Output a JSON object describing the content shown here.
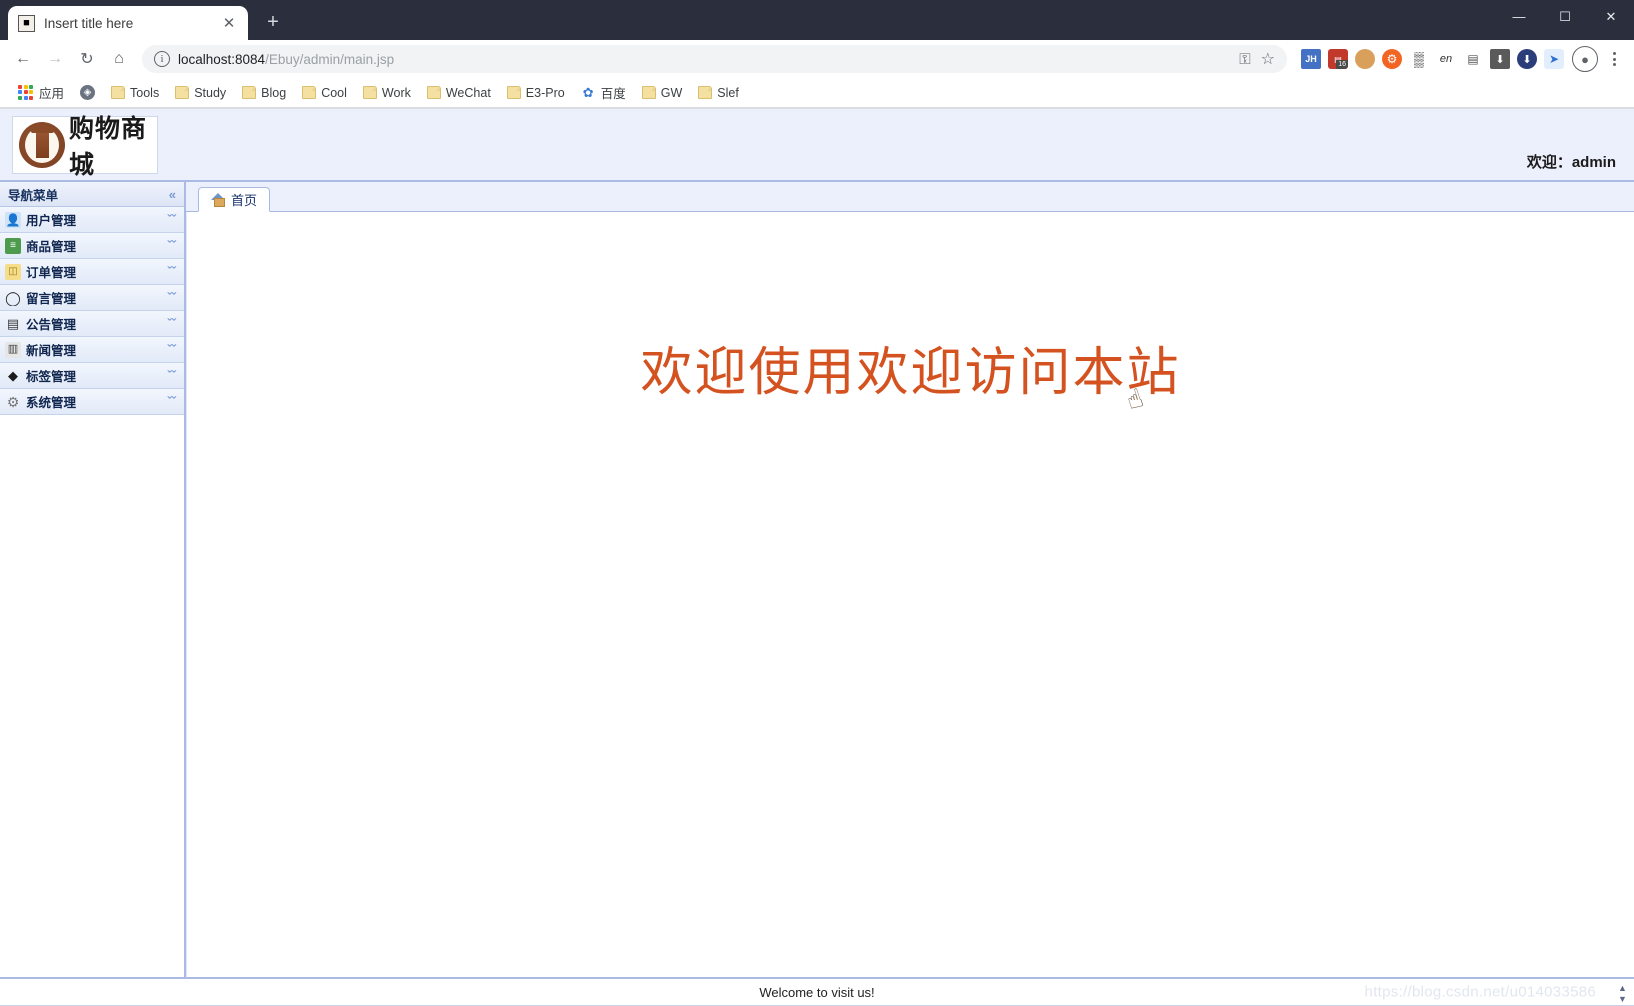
{
  "browser": {
    "tab": {
      "title": "Insert title here",
      "favicon": "jsp-favicon",
      "close_label": "✕"
    },
    "new_tab_label": "+",
    "window_controls": {
      "minimize": "—",
      "maximize": "☐",
      "close": "✕"
    },
    "nav": {
      "back": "←",
      "forward": "→",
      "reload": "↻",
      "home": "⌂"
    },
    "omnibox": {
      "host": "localhost:8084",
      "path": "/Ebuy/admin/main.jsp",
      "info_icon": "i",
      "key_icon": "⚿",
      "star_icon": "☆"
    },
    "extensions": [
      {
        "name": "jh-extension-icon",
        "label": "JH"
      },
      {
        "name": "calendar-extension-icon",
        "label": "▤",
        "badge": "16"
      },
      {
        "name": "monkey-extension-icon",
        "label": "●"
      },
      {
        "name": "orange-extension-icon",
        "label": "⚙"
      },
      {
        "name": "qrcode-extension-icon",
        "label": "▒"
      },
      {
        "name": "english-extension-icon",
        "label": "en"
      },
      {
        "name": "pdf-extension-icon",
        "label": "▤"
      },
      {
        "name": "download-extension-icon",
        "label": "⬇"
      },
      {
        "name": "globe-extension-icon",
        "label": "⬇"
      },
      {
        "name": "bird-extension-icon",
        "label": "➤"
      }
    ],
    "profile_icon": "●",
    "bookmarks": [
      {
        "label": "应用",
        "icon": "apps-grid-icon"
      },
      {
        "label": "",
        "icon": "globe-icon"
      },
      {
        "label": "Tools",
        "icon": "folder-icon"
      },
      {
        "label": "Study",
        "icon": "folder-icon"
      },
      {
        "label": "Blog",
        "icon": "folder-icon"
      },
      {
        "label": "Cool",
        "icon": "folder-icon"
      },
      {
        "label": "Work",
        "icon": "folder-icon"
      },
      {
        "label": "WeChat",
        "icon": "folder-icon"
      },
      {
        "label": "E3-Pro",
        "icon": "folder-icon"
      },
      {
        "label": "百度",
        "icon": "baidu-icon"
      },
      {
        "label": "GW",
        "icon": "folder-icon"
      },
      {
        "label": "Slef",
        "icon": "folder-icon"
      }
    ]
  },
  "site": {
    "logo_text": "购物商城",
    "welcome_user": "欢迎：admin"
  },
  "sidebar": {
    "panel_title": "导航菜单",
    "collapse_icon": "«",
    "expand_icon": "ˇˇ",
    "items": [
      {
        "label": "用户管理",
        "icon": "users-icon",
        "glyph": "👥"
      },
      {
        "label": "商品管理",
        "icon": "list-icon",
        "glyph": "≡"
      },
      {
        "label": "订单管理",
        "icon": "folder-icon",
        "glyph": "◫"
      },
      {
        "label": "留言管理",
        "icon": "chat-bubble-icon",
        "glyph": "◯"
      },
      {
        "label": "公告管理",
        "icon": "document-icon",
        "glyph": "▤"
      },
      {
        "label": "新闻管理",
        "icon": "newspaper-icon",
        "glyph": "▥"
      },
      {
        "label": "标签管理",
        "icon": "tag-icon",
        "glyph": "◆"
      },
      {
        "label": "系统管理",
        "icon": "gear-icon",
        "glyph": "⚙"
      }
    ]
  },
  "content": {
    "tabs": [
      {
        "label": "首页",
        "icon": "home-icon"
      }
    ],
    "hero_text": "欢迎使用欢迎访问本站",
    "hero_cursor_glyph": "☝"
  },
  "footer": {
    "text": "Welcome to visit us!",
    "watermark": "https://blog.csdn.net/u014033586",
    "scroll_up": "▲",
    "scroll_down": "▼"
  },
  "colors": {
    "chrome_titlebar": "#2b2f3d",
    "accent_blue": "#a9bbe4",
    "panel_bg": "#eceffc",
    "hero_orange": "#d4521f"
  }
}
